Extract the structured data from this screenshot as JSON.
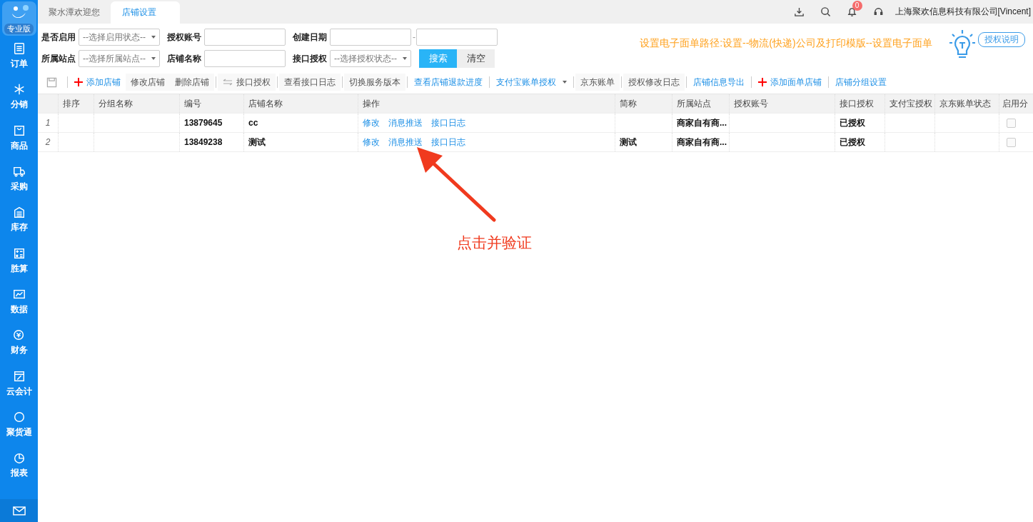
{
  "sidebar": {
    "logo_label": "专业版",
    "items": [
      {
        "label": "订单"
      },
      {
        "label": "分销"
      },
      {
        "label": "商品"
      },
      {
        "label": "采购"
      },
      {
        "label": "库存"
      },
      {
        "label": "胜算"
      },
      {
        "label": "数据"
      },
      {
        "label": "财务"
      },
      {
        "label": "云会计"
      },
      {
        "label": "聚货通"
      },
      {
        "label": "报表"
      }
    ]
  },
  "tabs": [
    {
      "label": "聚水潭欢迎您",
      "selected": false
    },
    {
      "label": "店铺设置",
      "selected": true
    }
  ],
  "header": {
    "notification_count": "0",
    "user": "上海聚欢信息科技有限公司[Vincent]"
  },
  "filters": [
    {
      "label": "是否启用",
      "kind": "select",
      "placeholder": "--选择启用状态--"
    },
    {
      "label": "授权账号",
      "kind": "input"
    },
    {
      "label": "创建日期",
      "kind": "range",
      "separator": "-"
    },
    {
      "label": "所属站点",
      "kind": "select",
      "placeholder": "--选择所属站点--"
    },
    {
      "label": "店铺名称",
      "kind": "input"
    },
    {
      "label": "接口授权",
      "kind": "select",
      "placeholder": "--选择授权状态--"
    }
  ],
  "filter_buttons": [
    {
      "label": "搜索",
      "primary": true
    },
    {
      "label": "清空",
      "primary": false
    }
  ],
  "notice": "设置电子面单路径:设置--物流(快递)公司及打印模版--设置电子面单",
  "help_bubble": "授权说明",
  "toolbar": [
    {
      "label": "添加店铺",
      "kind": "add",
      "separated": true
    },
    {
      "label": "修改店铺",
      "kind": "plain",
      "separated": false
    },
    {
      "label": "删除店铺",
      "kind": "plain",
      "separated": false
    },
    {
      "label": "接口授权",
      "kind": "swap",
      "separated": true
    },
    {
      "label": "查看接口日志",
      "kind": "plain",
      "separated": true
    },
    {
      "label": "切换服务版本",
      "kind": "plain",
      "separated": true
    },
    {
      "label": "查看店铺退款进度",
      "kind": "link",
      "separated": true
    },
    {
      "label": "支付宝账单授权",
      "kind": "dropdown",
      "separated": true
    },
    {
      "label": "京东账单",
      "kind": "plain",
      "separated": true
    },
    {
      "label": "授权修改日志",
      "kind": "plain",
      "separated": true
    },
    {
      "label": "店铺信息导出",
      "kind": "link",
      "separated": true
    },
    {
      "label": "添加面单店铺",
      "kind": "add",
      "separated": true
    },
    {
      "label": "店铺分组设置",
      "kind": "link",
      "separated": true
    }
  ],
  "table": {
    "columns": [
      "排序",
      "分组名称",
      "编号",
      "店铺名称",
      "操作",
      "简称",
      "所属站点",
      "授权账号",
      "接口授权",
      "支付宝授权",
      "京东账单状态",
      "启用分"
    ],
    "rows": [
      {
        "index": "1",
        "sort": "",
        "group": "",
        "id": "13879645",
        "name": "cc",
        "actions": [
          "修改",
          "消息推送",
          "接口日志"
        ],
        "short_name": "",
        "site": "商家自有商...",
        "account": "",
        "api_auth": "已授权",
        "alipay_auth": "",
        "jd_status": "",
        "enabled": false
      },
      {
        "index": "2",
        "sort": "",
        "group": "",
        "id": "13849238",
        "name": "测试",
        "actions": [
          "修改",
          "消息推送",
          "接口日志"
        ],
        "short_name": "测试",
        "site": "商家自有商...",
        "account": "",
        "api_auth": "已授权",
        "alipay_auth": "",
        "jd_status": "",
        "enabled": false
      }
    ]
  },
  "annotation": "点击并验证"
}
